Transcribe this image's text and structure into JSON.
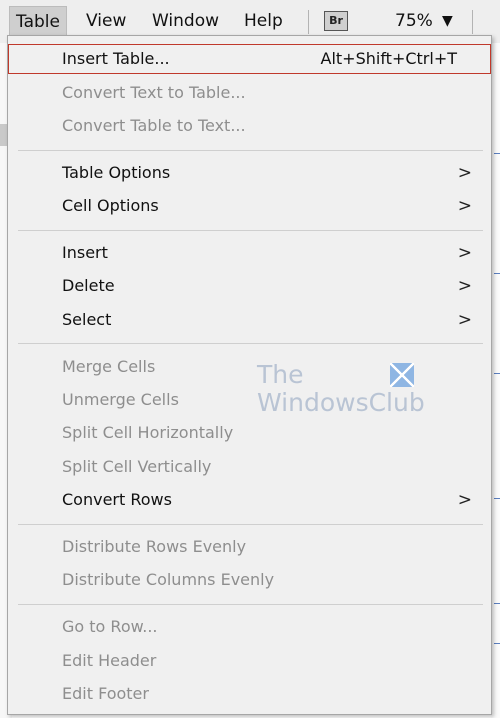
{
  "menubar": {
    "items": [
      "Table",
      "View",
      "Window",
      "Help"
    ],
    "bridge_badge": "Br",
    "zoom": "75%",
    "zoom_caret": "▼"
  },
  "menu": {
    "items": [
      {
        "label": "Insert Table...",
        "shortcut": "Alt+Shift+Ctrl+T",
        "enabled": true,
        "highlighted": true
      },
      {
        "label": "Convert Text to Table...",
        "enabled": false
      },
      {
        "label": "Convert Table to Text...",
        "enabled": false
      },
      {
        "label": "Table Options",
        "enabled": true,
        "submenu": true
      },
      {
        "label": "Cell Options",
        "enabled": true,
        "submenu": true
      },
      {
        "label": "Insert",
        "enabled": true,
        "submenu": true
      },
      {
        "label": "Delete",
        "enabled": true,
        "submenu": true
      },
      {
        "label": "Select",
        "enabled": true,
        "submenu": true
      },
      {
        "label": "Merge Cells",
        "enabled": false
      },
      {
        "label": "Unmerge Cells",
        "enabled": false
      },
      {
        "label": "Split Cell Horizontally",
        "enabled": false
      },
      {
        "label": "Split Cell Vertically",
        "enabled": false
      },
      {
        "label": "Convert Rows",
        "enabled": true,
        "submenu": true
      },
      {
        "label": "Distribute Rows Evenly",
        "enabled": false
      },
      {
        "label": "Distribute Columns Evenly",
        "enabled": false
      },
      {
        "label": "Go to Row...",
        "enabled": false
      },
      {
        "label": "Edit Header",
        "enabled": false
      },
      {
        "label": "Edit Footer",
        "enabled": false
      }
    ],
    "submenu_arrow": ">"
  },
  "watermark": {
    "line1": "The",
    "line2": "WindowsClub"
  },
  "colors": {
    "highlight_border": "#c0392b",
    "disabled_text": "#8e8e8e",
    "menu_bg": "#f0f0f0"
  }
}
